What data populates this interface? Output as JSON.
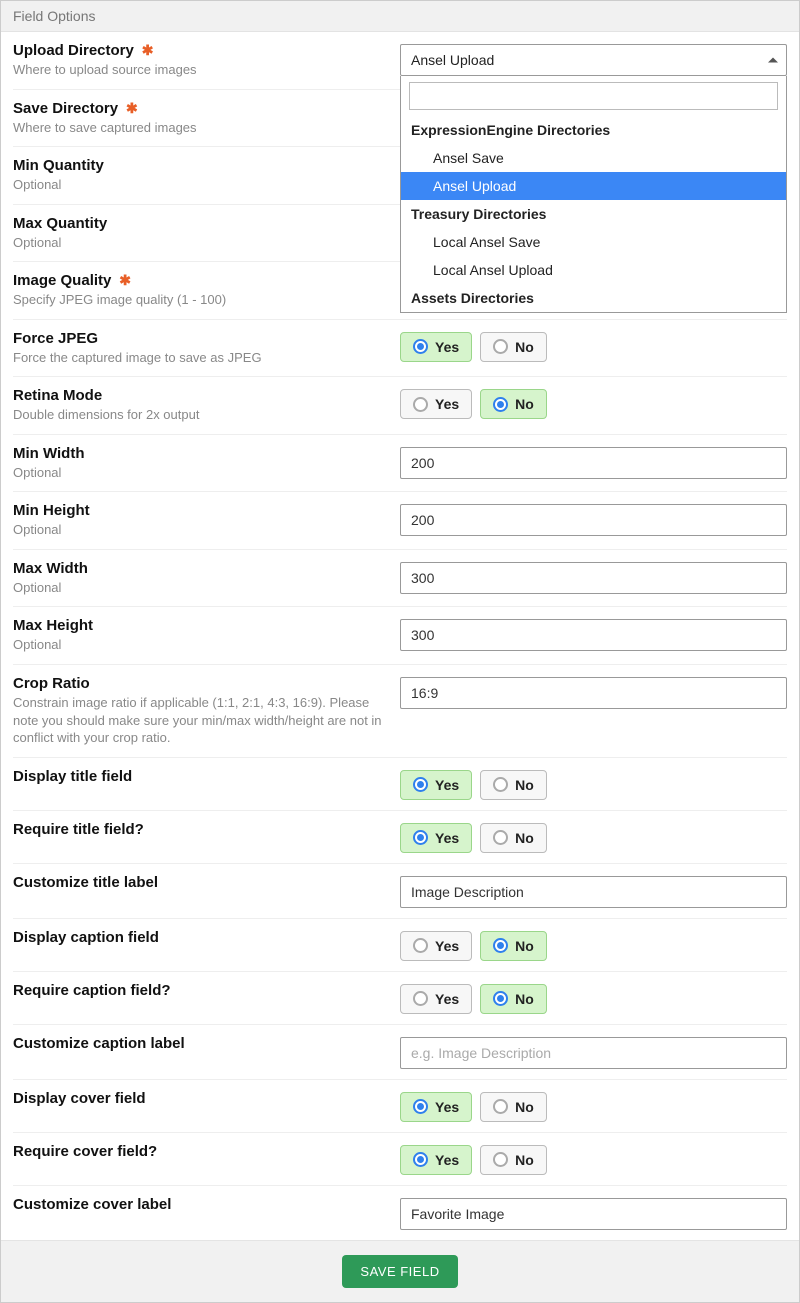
{
  "header": {
    "title": "Field Options"
  },
  "uploadDirectory": {
    "label": "Upload Directory",
    "help": "Where to upload source images",
    "selected": "Ansel Upload",
    "dropdown": {
      "search": "",
      "groups": [
        {
          "label": "ExpressionEngine Directories",
          "items": [
            "Ansel Save",
            "Ansel Upload"
          ],
          "selected": "Ansel Upload"
        },
        {
          "label": "Treasury Directories",
          "items": [
            "Local Ansel Save",
            "Local Ansel Upload"
          ]
        },
        {
          "label": "Assets Directories",
          "items": []
        }
      ]
    }
  },
  "saveDirectory": {
    "label": "Save Directory",
    "help": "Where to save captured images"
  },
  "minQuantity": {
    "label": "Min Quantity",
    "help": "Optional",
    "value": ""
  },
  "maxQuantity": {
    "label": "Max Quantity",
    "help": "Optional",
    "value": ""
  },
  "imageQuality": {
    "label": "Image Quality",
    "help": "Specify JPEG image quality (1 - 100)",
    "value": ""
  },
  "forceJpeg": {
    "label": "Force JPEG",
    "help": "Force the captured image to save as JPEG",
    "value": "Yes"
  },
  "retinaMode": {
    "label": "Retina Mode",
    "help": "Double dimensions for 2x output",
    "value": "No"
  },
  "minWidth": {
    "label": "Min Width",
    "help": "Optional",
    "value": "200"
  },
  "minHeight": {
    "label": "Min Height",
    "help": "Optional",
    "value": "200"
  },
  "maxWidth": {
    "label": "Max Width",
    "help": "Optional",
    "value": "300"
  },
  "maxHeight": {
    "label": "Max Height",
    "help": "Optional",
    "value": "300"
  },
  "cropRatio": {
    "label": "Crop Ratio",
    "help": "Constrain image ratio if applicable (1:1, 2:1, 4:3, 16:9). Please note you should make sure your min/max width/height are not in conflict with your crop ratio.",
    "value": "16:9"
  },
  "displayTitle": {
    "label": "Display title field",
    "value": "Yes"
  },
  "requireTitle": {
    "label": "Require title field?",
    "value": "Yes"
  },
  "customizeTitle": {
    "label": "Customize title label",
    "value": "Image Description"
  },
  "displayCaption": {
    "label": "Display caption field",
    "value": "No"
  },
  "requireCaption": {
    "label": "Require caption field?",
    "value": "No"
  },
  "customizeCaption": {
    "label": "Customize caption label",
    "value": "",
    "placeholder": "e.g. Image Description"
  },
  "displayCover": {
    "label": "Display cover field",
    "value": "Yes"
  },
  "requireCover": {
    "label": "Require cover field?",
    "value": "Yes"
  },
  "customizeCover": {
    "label": "Customize cover label",
    "value": "Favorite Image"
  },
  "yesNo": {
    "yes": "Yes",
    "no": "No"
  },
  "footer": {
    "save": "SAVE FIELD"
  }
}
